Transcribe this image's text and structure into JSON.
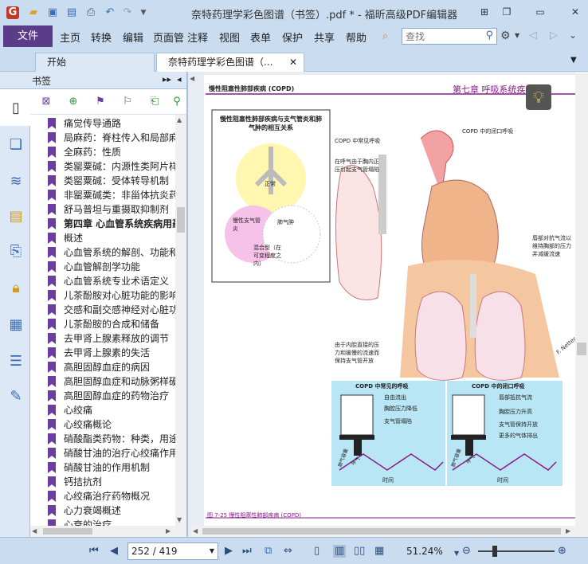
{
  "window": {
    "title": "奈特药理学彩色图谱（书签）.pdf * - 福昕高级PDF编辑器"
  },
  "menu": {
    "file": "文件",
    "items": [
      "主页",
      "转换",
      "编辑",
      "页面管理",
      "注释",
      "视图",
      "表单",
      "保护",
      "共享",
      "帮助"
    ],
    "search_placeholder": "查找"
  },
  "tabs": [
    {
      "label": "开始"
    },
    {
      "label": "奈特药理学彩色图谱（..."
    }
  ],
  "bookmarks": {
    "header": "书签",
    "items": [
      "痛觉传导通路",
      "局麻药：脊柱传入和局部麻醉",
      "全麻药：性质",
      "类罂粟碱：内源性类阿片样物质",
      "类罂粟碱：受体转导机制",
      "非罂粟碱类：非甾体抗炎药",
      "舒马普坦与重摄取抑制剂",
      "第四章  心血管系统疾病用药",
      "概述",
      "心血管系统的解剖、功能和结构",
      "心血管解剖学功能",
      "心血管系统专业术语定义",
      "儿茶酚胺对心脏功能的影响",
      "交感和副交感神经对心脏功能",
      "儿茶酚胺的合成和储备",
      "去甲肾上腺素释放的调节",
      "去甲肾上腺素的失活",
      "高胆固醇血症的病因",
      "高胆固醇血症和动脉粥样硬化",
      "高胆固醇血症的药物治疗",
      "心绞痛",
      "心绞痛概论",
      "硝酸酯类药物：种类，用途",
      "硝酸甘油的治疗心绞痛作用",
      "硝酸甘油的作用机制",
      "钙拮抗剂",
      "心绞痛治疗药物概况",
      "心力衰竭概述",
      "心衰的治疗"
    ]
  },
  "document": {
    "header_left": "慢性阻塞性肺部疾病 (COPD)",
    "header_right": "第七章   呼吸系统疾病用药",
    "inset_title": "慢性阻塞性肺部疾病与支气管炎和肺气肿的相互关系",
    "venn_normal": "正常",
    "venn_bronchitis": "慢性支气管炎",
    "venn_emphysema": "肺气肿",
    "venn_mixed": "混合型（在可变程度之内）",
    "label_copd_normal_breath": "COPD 中常见呼吸",
    "label_copd_closed_breath": "COPD 中的闭口呼吸",
    "label_chest_pressure": "在呼气由于胸内正压引起支气管塌陷",
    "label_lips": "唇部对抗气流以维持胸部的压力并减缓流速",
    "label_intrathoracic": "由于内腔直接的压力和缓慢的流速而保持支气管开放",
    "panel_left_title": "COPD 中常见的呼吸",
    "panel_left_items": [
      "自由流出",
      "胸腔压力降低",
      "支气管塌陷"
    ],
    "panel_right_title": "COPD 中的闭口呼吸",
    "panel_right_items": [
      "唇部抵抗气流",
      "胸腔压力升高",
      "支气管保持开放",
      "更多的气体排出"
    ],
    "axis_volume": "肺气容量",
    "axis_expiration": "呼气",
    "axis_time": "时间",
    "artist": "F. Netter",
    "footer": "图 7-25   慢性阻塞性肺部疾病 (COPD)"
  },
  "statusbar": {
    "page": "252 / 419",
    "zoom": "51.24%"
  },
  "colors": {
    "accent": "#5b3c88",
    "ribbon": "#c9dcf0",
    "bookmark_flag": "#6b3fa0",
    "doc_header": "#8a1a8a"
  },
  "icons": {
    "app": "foxit-logo-icon",
    "tip": "lightbulb-icon"
  }
}
